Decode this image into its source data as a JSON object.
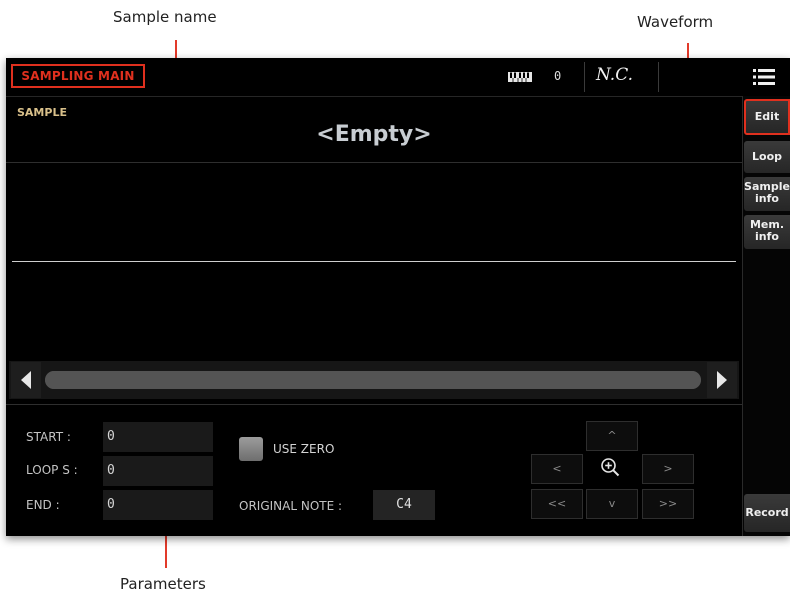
{
  "callouts": {
    "sample_name": "Sample name",
    "waveform": "Waveform",
    "parameters": "Parameters"
  },
  "header": {
    "title": "SAMPLING MAIN",
    "keyboard_icon": "keyboard-icon",
    "keyboard_value": "0",
    "chord": "N.C.",
    "menu_icon": "hamburger-menu-icon"
  },
  "sample": {
    "label": "SAMPLE",
    "name": "<Empty>"
  },
  "scrollbar": {
    "left_icon": "scroll-left-arrow-icon",
    "right_icon": "scroll-right-arrow-icon"
  },
  "params": {
    "start_label": "START :",
    "start_value": "0",
    "loop_label": "LOOP S :",
    "loop_value": "0",
    "end_label": "END :",
    "end_value": "0",
    "use_zero_label": "USE ZERO",
    "original_note_label": "ORIGINAL NOTE :",
    "original_note_value": "C4"
  },
  "nav": {
    "up": "^",
    "left": "<",
    "right": ">",
    "down": "v",
    "page_left": "<<",
    "page_right": ">>",
    "zoom_icon": "zoom-in-icon"
  },
  "sidebar": {
    "edit": "Edit",
    "loop": "Loop",
    "sample_info": [
      "Sample",
      "info"
    ],
    "mem_info": [
      "Mem.",
      "info"
    ],
    "record": "Record"
  },
  "colors": {
    "accent": "#e0301e",
    "sample_label": "#d9c08a",
    "background": "#000000"
  }
}
